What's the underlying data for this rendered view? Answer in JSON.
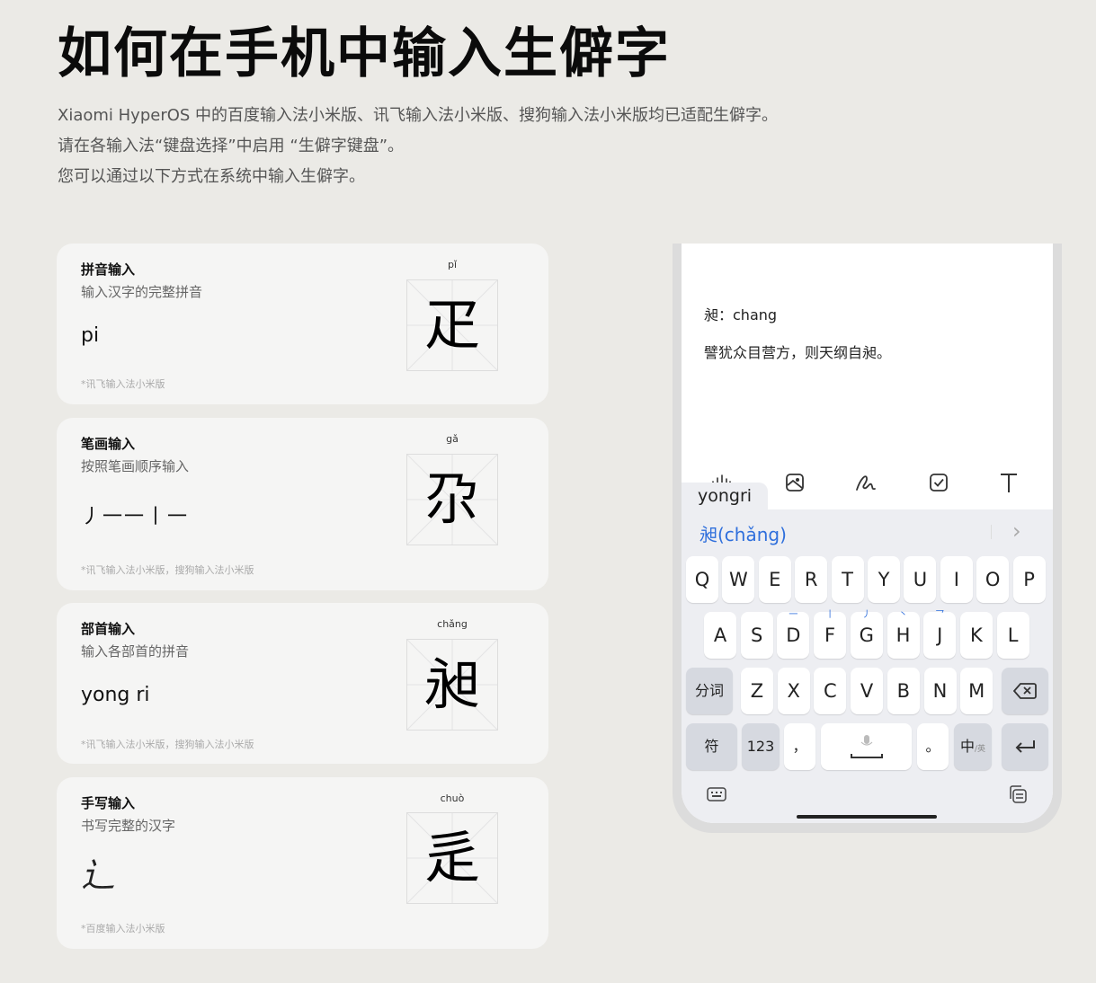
{
  "page": {
    "title": "如何在手机中输入生僻字",
    "intro": [
      "Xiaomi HyperOS 中的百度输入法小米版、讯飞输入法小米版、搜狗输入法小米版均已适配生僻字。",
      "请在各输入法“键盘选择”中启用 “生僻字键盘”。",
      "您可以通过以下方式在系统中输入生僻字。"
    ]
  },
  "cards": [
    {
      "name": "拼音输入",
      "desc": "输入汉字的完整拼音",
      "example": "pi",
      "note": "*讯飞输入法小米版",
      "pinyin": "pǐ",
      "char": "疋"
    },
    {
      "name": "笔画输入",
      "desc": "按照笔画顺序输入",
      "example": "丿一一丨一",
      "note": "*讯飞输入法小米版，搜狗输入法小米版",
      "pinyin": "gǎ",
      "char": "尕"
    },
    {
      "name": "部首输入",
      "desc": "输入各部首的拼音",
      "example": "yong ri",
      "note": "*讯飞输入法小米版，搜狗输入法小米版",
      "pinyin": "chǎng",
      "char": "昶"
    },
    {
      "name": "手写输入",
      "desc": "书写完整的汉字",
      "example": "辶",
      "note": "*百度输入法小米版",
      "pinyin": "chuò",
      "char": "辵"
    }
  ],
  "phone": {
    "note_line1": "昶：chang",
    "note_line2": "譬犹众目营方，则天纲自昶。",
    "composition": "yongri",
    "candidate": "昶(chǎng)",
    "toolbar_icons": [
      "audio-wave-icon",
      "image-icon",
      "handwriting-icon",
      "checkbox-icon",
      "text-icon"
    ],
    "row1": [
      "Q",
      "W",
      "E",
      "R",
      "T",
      "Y",
      "U",
      "I",
      "O",
      "P"
    ],
    "row2": [
      {
        "k": "A",
        "h": ""
      },
      {
        "k": "S",
        "h": ""
      },
      {
        "k": "D",
        "h": "一"
      },
      {
        "k": "F",
        "h": "丨"
      },
      {
        "k": "G",
        "h": "丿"
      },
      {
        "k": "H",
        "h": "丶"
      },
      {
        "k": "J",
        "h": "乛"
      },
      {
        "k": "K",
        "h": ""
      },
      {
        "k": "L",
        "h": ""
      }
    ],
    "row3_left": "分词",
    "row3": [
      "Z",
      "X",
      "C",
      "V",
      "B",
      "N",
      "M"
    ],
    "row4": {
      "symbols": "符",
      "numbers": "123",
      "comma": "，",
      "period": "。",
      "lang": "中",
      "lang_sub": "/英"
    }
  }
}
